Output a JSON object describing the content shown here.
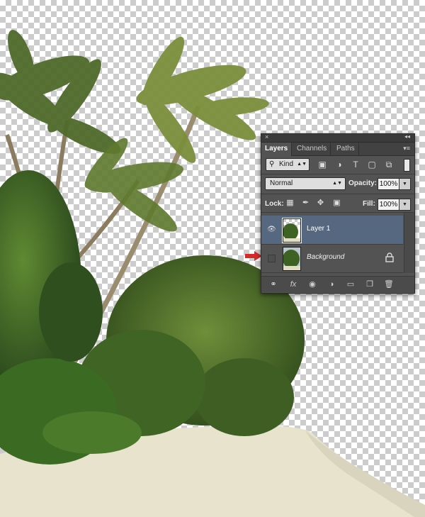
{
  "panel": {
    "close_glyph": "×",
    "collapse_glyph": "◂◂",
    "tabs": [
      {
        "label": "Layers",
        "active": true
      },
      {
        "label": "Channels",
        "active": false
      },
      {
        "label": "Paths",
        "active": false
      }
    ],
    "menu_glyph": "▾≡",
    "filter": {
      "kind_label": "Kind",
      "icons": [
        "image-filter-icon",
        "adjustment-filter-icon",
        "type-filter-icon",
        "shape-filter-icon",
        "smart-object-filter-icon"
      ]
    },
    "blend_mode": "Normal",
    "opacity_label": "Opacity:",
    "opacity_value": "100%",
    "lock_label": "Lock:",
    "fill_label": "Fill:",
    "fill_value": "100%",
    "layers": [
      {
        "name": "Layer 1",
        "visible": true,
        "selected": true,
        "locked": false
      },
      {
        "name": "Background",
        "visible": false,
        "selected": false,
        "locked": true
      }
    ],
    "footer_icons": [
      "link-layers-icon",
      "fx-icon",
      "add-mask-icon",
      "adjustment-layer-icon",
      "group-folder-icon",
      "new-layer-icon",
      "trash-icon"
    ]
  },
  "colors": {
    "panel_bg": "#535353",
    "selected_row": "#56687f",
    "pointer_arrow": "#d42a2a"
  }
}
